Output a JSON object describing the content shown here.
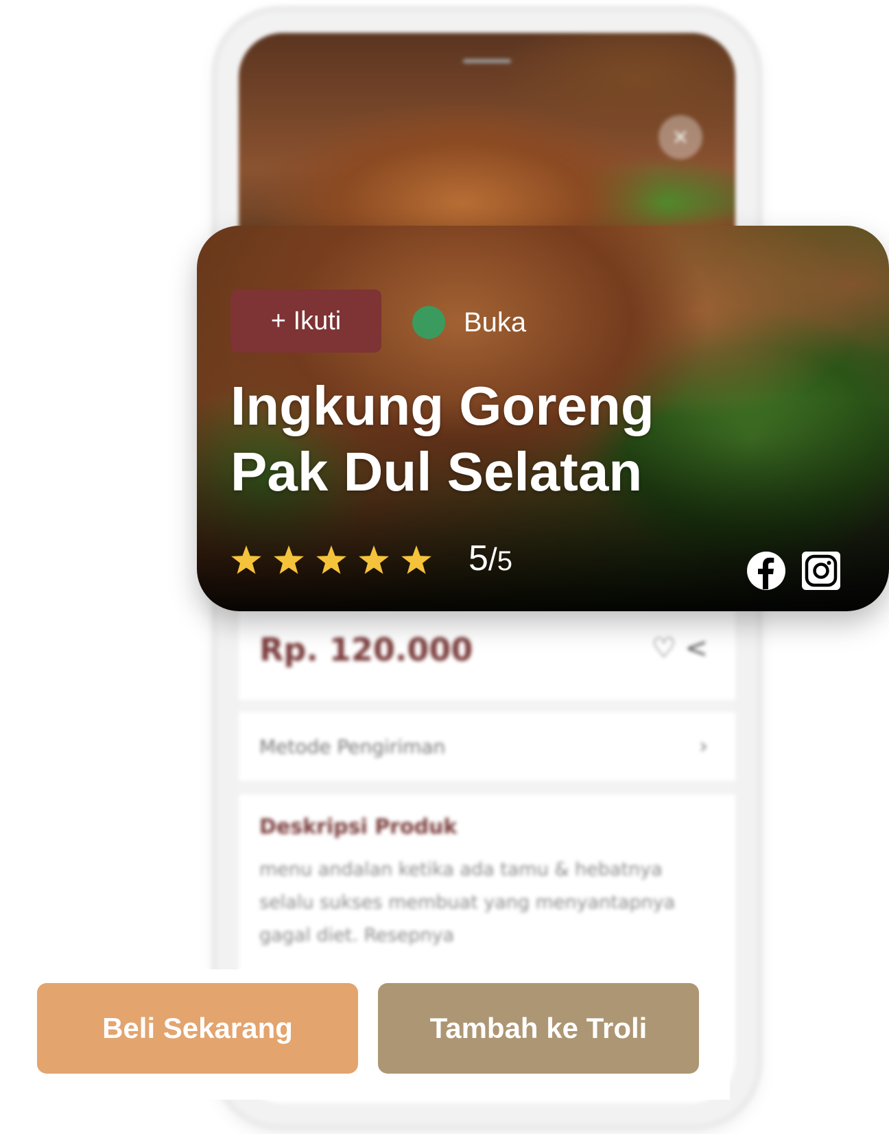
{
  "product": {
    "price": "Rp. 120.000",
    "shipping_label": "Metode Pengiriman",
    "description_title": "Deskripsi Produk",
    "description_text": "menu andalan ketika ada tamu & hebatnya selalu sukses membuat yang menyantapnya gagal diet. Resepnya"
  },
  "store_card": {
    "follow_label": "+ Ikuti",
    "status_label": "Buka",
    "status_color": "#3b9b5f",
    "name_line1": "Ingkung Goreng",
    "name_line2": "Pak Dul Selatan",
    "rating_value": "5",
    "rating_sep": "/",
    "rating_max": "5",
    "star_count": 5,
    "star_color": "#f5c33b",
    "social": [
      "facebook-icon",
      "instagram-icon"
    ]
  },
  "actions": {
    "buy_label": "Beli Sekarang",
    "cart_label": "Tambah ke Troli",
    "buy_color": "#e3a46e",
    "cart_color": "#ad9673"
  },
  "colors": {
    "brand_maroon": "#7e3334"
  }
}
